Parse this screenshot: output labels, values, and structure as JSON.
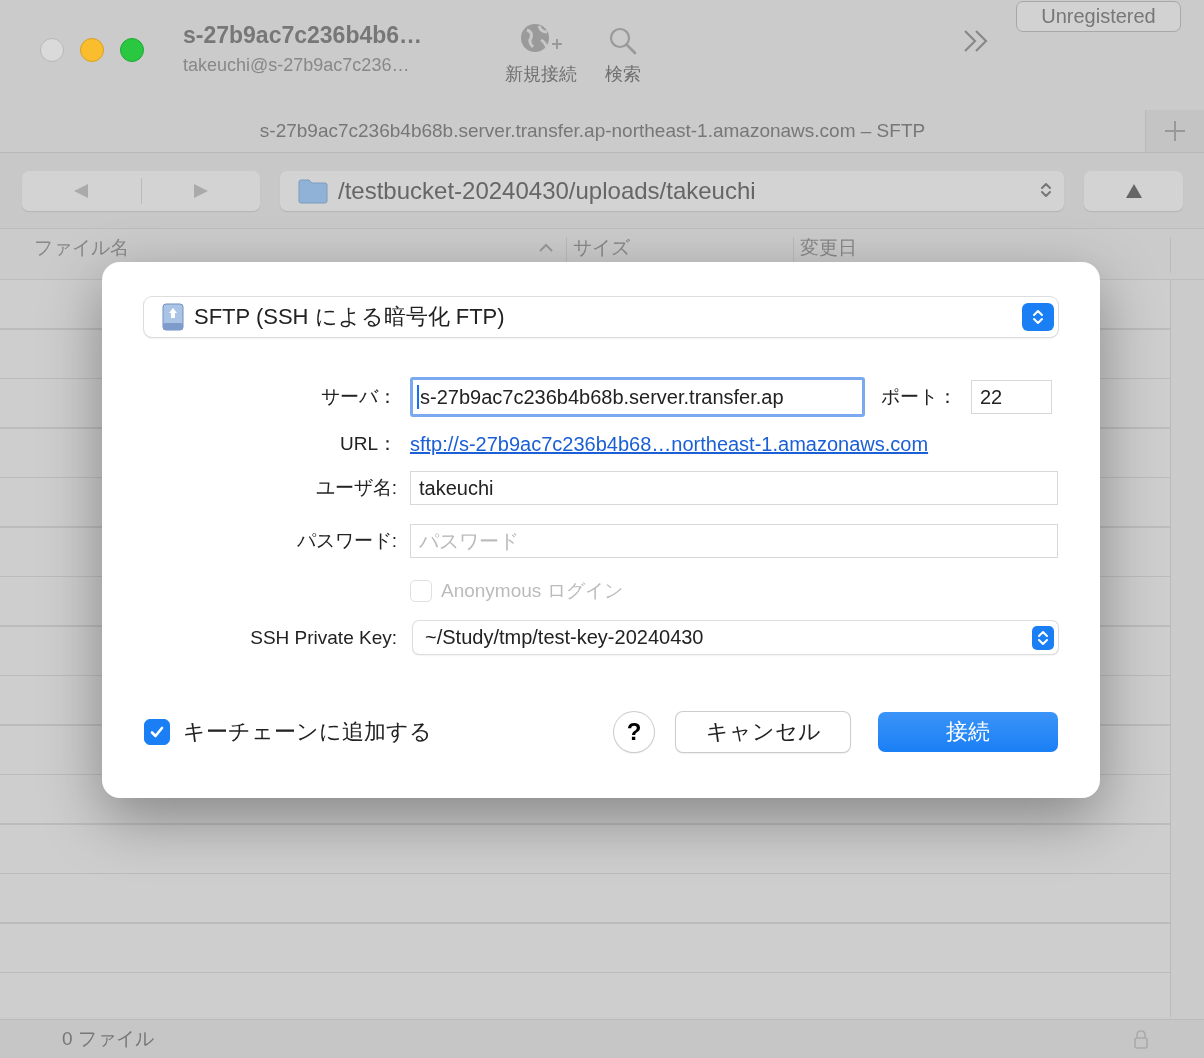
{
  "window": {
    "title": "s-27b9ac7c236b4b6…",
    "subtitle": "takeuchi@s-27b9ac7c236…",
    "badge": "Unregistered"
  },
  "toolbar": [
    {
      "kind": "new-connection",
      "label": "新規接続",
      "disabled": true
    },
    {
      "kind": "search",
      "label": "検索",
      "disabled": true
    }
  ],
  "tab": {
    "title": "s-27b9ac7c236b4b68b.server.transfer.ap-northeast-1.amazonaws.com – SFTP"
  },
  "path_bar": {
    "path": "/testbucket-20240430/uploads/takeuchi"
  },
  "columns": [
    {
      "label": "ファイル名",
      "sorted": true
    },
    {
      "label": "サイズ",
      "sorted": false
    },
    {
      "label": "変更日",
      "sorted": false
    }
  ],
  "dialog": {
    "protocol": "SFTP (SSH による暗号化 FTP)",
    "server_label": "サーバ：",
    "server": "s-27b9ac7c236b4b68b.server.transfer.ap",
    "port_label": "ポート：",
    "port": "22",
    "url_label": "URL：",
    "url": "sftp://s-27b9ac7c236b4b68…northeast-1.amazonaws.com",
    "username_label": "ユーザ名:",
    "username": "takeuchi",
    "password_label": "パスワード:",
    "password_placeholder": "パスワード",
    "anonymous": {
      "label": "Anonymous ログイン",
      "checked": false,
      "disabled": true
    },
    "key_label": "SSH Private Key:",
    "key": "~/Study/tmp/test-key-20240430",
    "keychain": {
      "label": "キーチェーンに追加する",
      "checked": true
    },
    "help": "?",
    "cancel": "キャンセル",
    "connect": "接続"
  },
  "status_bar": {
    "count": "0 ファイル"
  }
}
